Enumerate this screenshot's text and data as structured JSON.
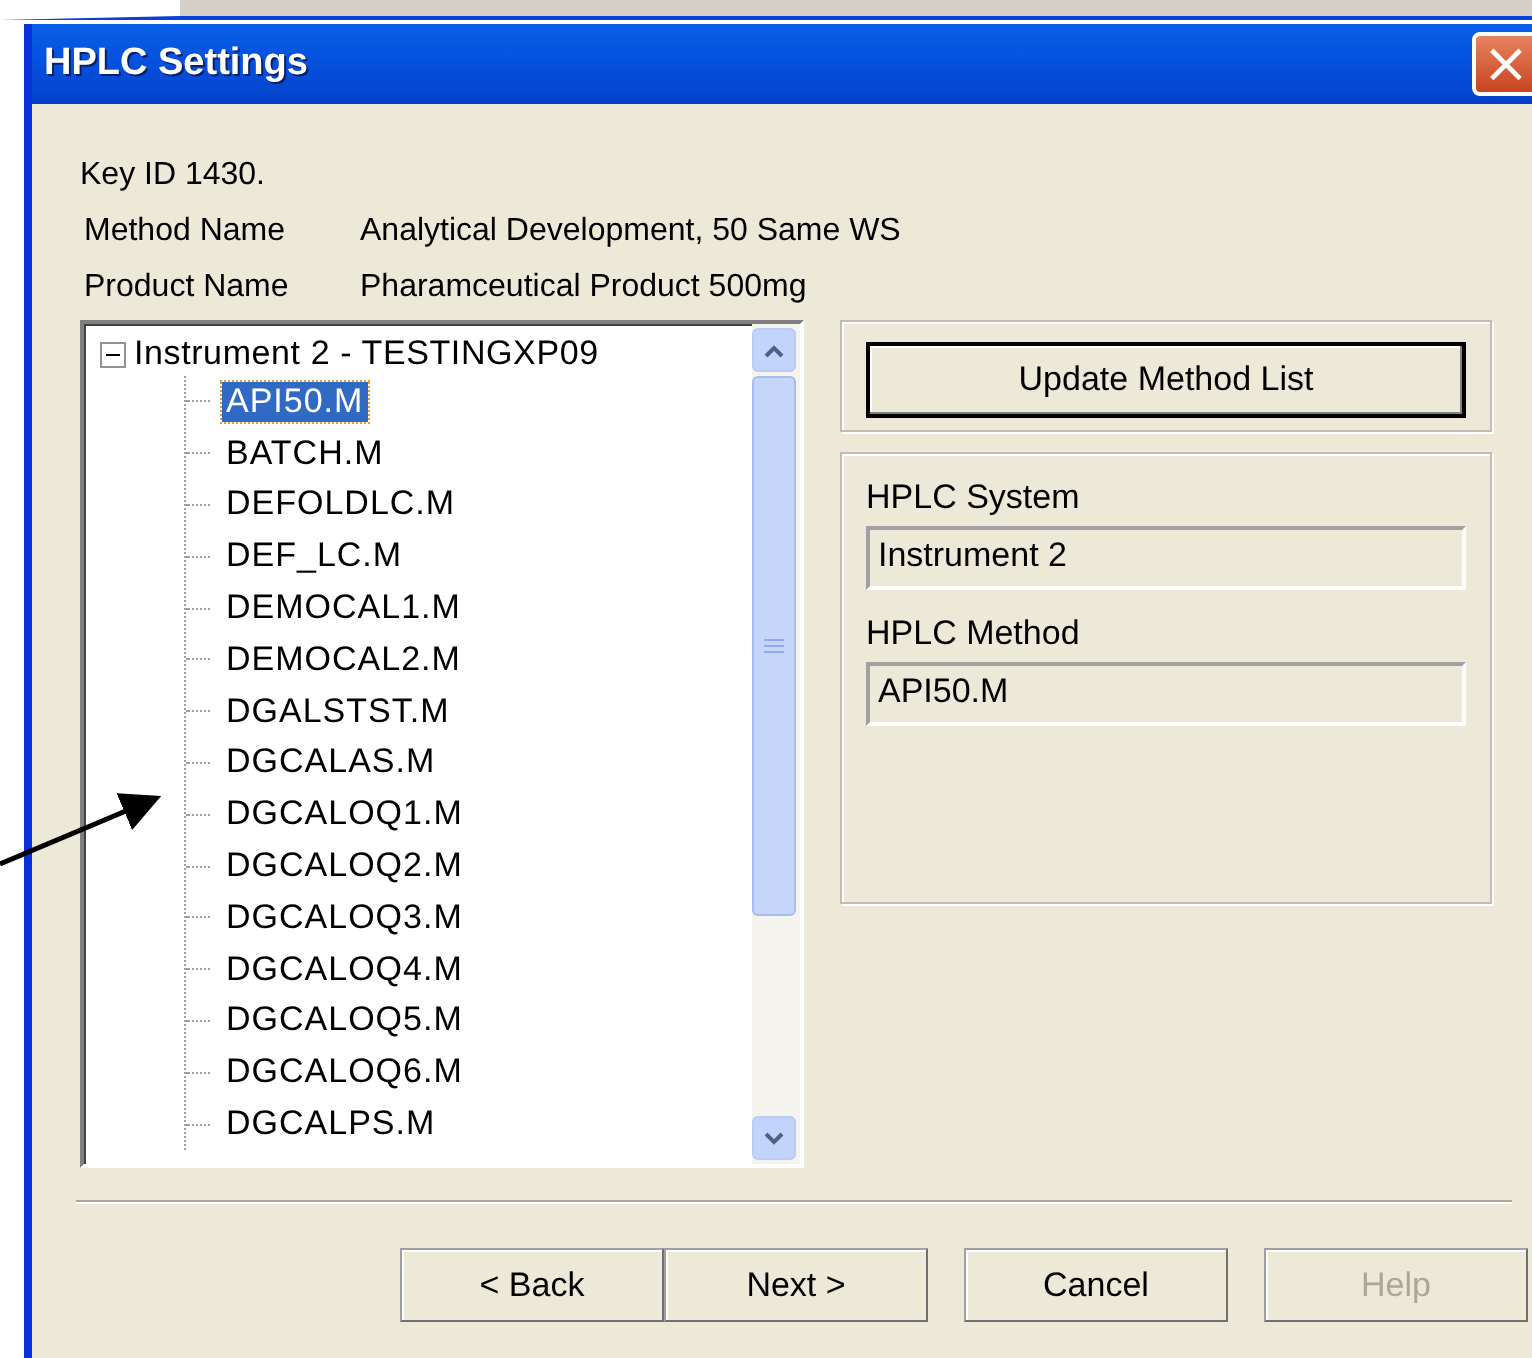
{
  "window": {
    "title": "HPLC Settings",
    "close": "×"
  },
  "info": {
    "key_id": "Key ID 1430.",
    "fields": [
      {
        "label": "Method Name",
        "value": "Analytical Development, 50 Same WS"
      },
      {
        "label": "Product Name",
        "value": "Pharamceutical Product 500mg"
      }
    ]
  },
  "tree": {
    "root": {
      "label": "Instrument 2 - TESTINGXP09",
      "expanded": true,
      "children": [
        {
          "label": "API50.M",
          "selected": true
        },
        {
          "label": "BATCH.M",
          "selected": false
        },
        {
          "label": "DEFOLDLC.M",
          "selected": false
        },
        {
          "label": "DEF_LC.M",
          "selected": false
        },
        {
          "label": "DEMOCAL1.M",
          "selected": false
        },
        {
          "label": "DEMOCAL2.M",
          "selected": false
        },
        {
          "label": "DGALSTST.M",
          "selected": false
        },
        {
          "label": "DGCALAS.M",
          "selected": false
        },
        {
          "label": "DGCALOQ1.M",
          "selected": false
        },
        {
          "label": "DGCALOQ2.M",
          "selected": false
        },
        {
          "label": "DGCALOQ3.M",
          "selected": false
        },
        {
          "label": "DGCALOQ4.M",
          "selected": false
        },
        {
          "label": "DGCALOQ5.M",
          "selected": false
        },
        {
          "label": "DGCALOQ6.M",
          "selected": false
        },
        {
          "label": "DGCALPS.M",
          "selected": false
        }
      ]
    }
  },
  "update_button": "Update Method List",
  "system": {
    "label": "HPLC System",
    "value": "Instrument 2"
  },
  "method": {
    "label": "HPLC Method",
    "value": "API50.M"
  },
  "buttons": [
    {
      "label": "< Back",
      "disabled": false
    },
    {
      "label": "Next >",
      "disabled": false
    },
    {
      "label": "Cancel",
      "disabled": false
    },
    {
      "label": "Help",
      "disabled": true
    }
  ]
}
